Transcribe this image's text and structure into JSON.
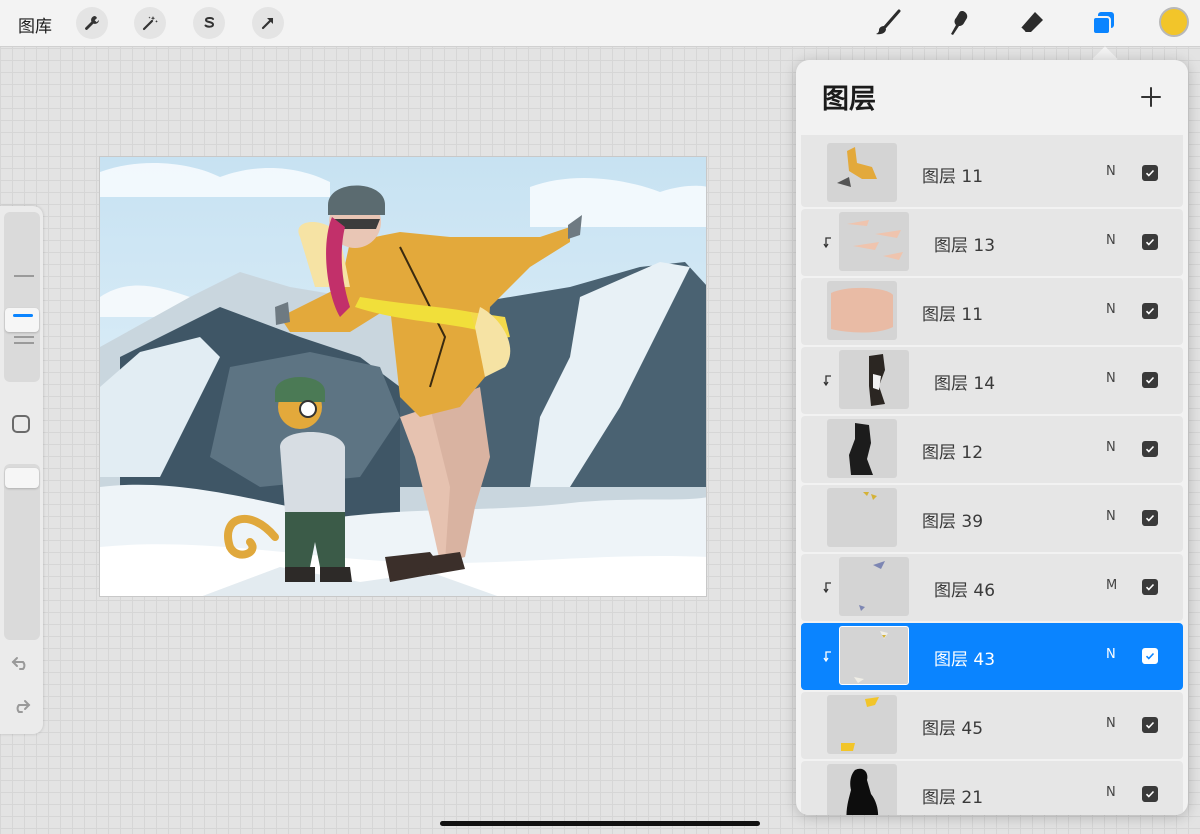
{
  "topbar": {
    "gallery_label": "图库",
    "left_tools": [
      {
        "icon": "wrench-icon",
        "label": "actions"
      },
      {
        "icon": "magic-wand-icon",
        "label": "adjustments"
      },
      {
        "icon": "selection-s-icon",
        "label": "selection"
      },
      {
        "icon": "arrow-transform-icon",
        "label": "transform"
      }
    ],
    "right_tools": [
      {
        "icon": "brush-icon"
      },
      {
        "icon": "smudge-icon"
      },
      {
        "icon": "eraser-icon"
      },
      {
        "icon": "layers-icon",
        "active": true
      }
    ],
    "current_color": "#f2c52a"
  },
  "sidebar": {
    "brush_size_icon": "slider",
    "opacity_icon": "slider",
    "modify_button": "square-icon",
    "undo_icon": "undo-arrow-icon",
    "redo_icon": "redo-arrow-icon"
  },
  "layers_panel": {
    "title": "图层",
    "add_icon": "plus-icon",
    "accent": "#0a84ff",
    "layers": [
      {
        "name": "图层 11",
        "mode": "N",
        "visible": true,
        "clipped": false,
        "selected": false,
        "thumb": "yellow-arm"
      },
      {
        "name": "图层 13",
        "mode": "N",
        "visible": true,
        "clipped": true,
        "selected": false,
        "thumb": "peach-strokes"
      },
      {
        "name": "图层 11",
        "mode": "N",
        "visible": true,
        "clipped": false,
        "selected": false,
        "thumb": "peach-blob"
      },
      {
        "name": "图层 14",
        "mode": "N",
        "visible": true,
        "clipped": true,
        "selected": false,
        "thumb": "dark-boot"
      },
      {
        "name": "图层 12",
        "mode": "N",
        "visible": true,
        "clipped": false,
        "selected": false,
        "thumb": "black-shape"
      },
      {
        "name": "图层 39",
        "mode": "N",
        "visible": true,
        "clipped": false,
        "selected": false,
        "thumb": "yellow-dots"
      },
      {
        "name": "图层 46",
        "mode": "M",
        "visible": true,
        "clipped": true,
        "selected": false,
        "thumb": "blue-marks"
      },
      {
        "name": "图层 43",
        "mode": "N",
        "visible": true,
        "clipped": true,
        "selected": true,
        "thumb": "light-marks"
      },
      {
        "name": "图层 45",
        "mode": "N",
        "visible": true,
        "clipped": false,
        "selected": false,
        "thumb": "yellow-patches"
      },
      {
        "name": "图层 21",
        "mode": "N",
        "visible": true,
        "clipped": false,
        "selected": false,
        "thumb": "black-figure"
      }
    ]
  }
}
